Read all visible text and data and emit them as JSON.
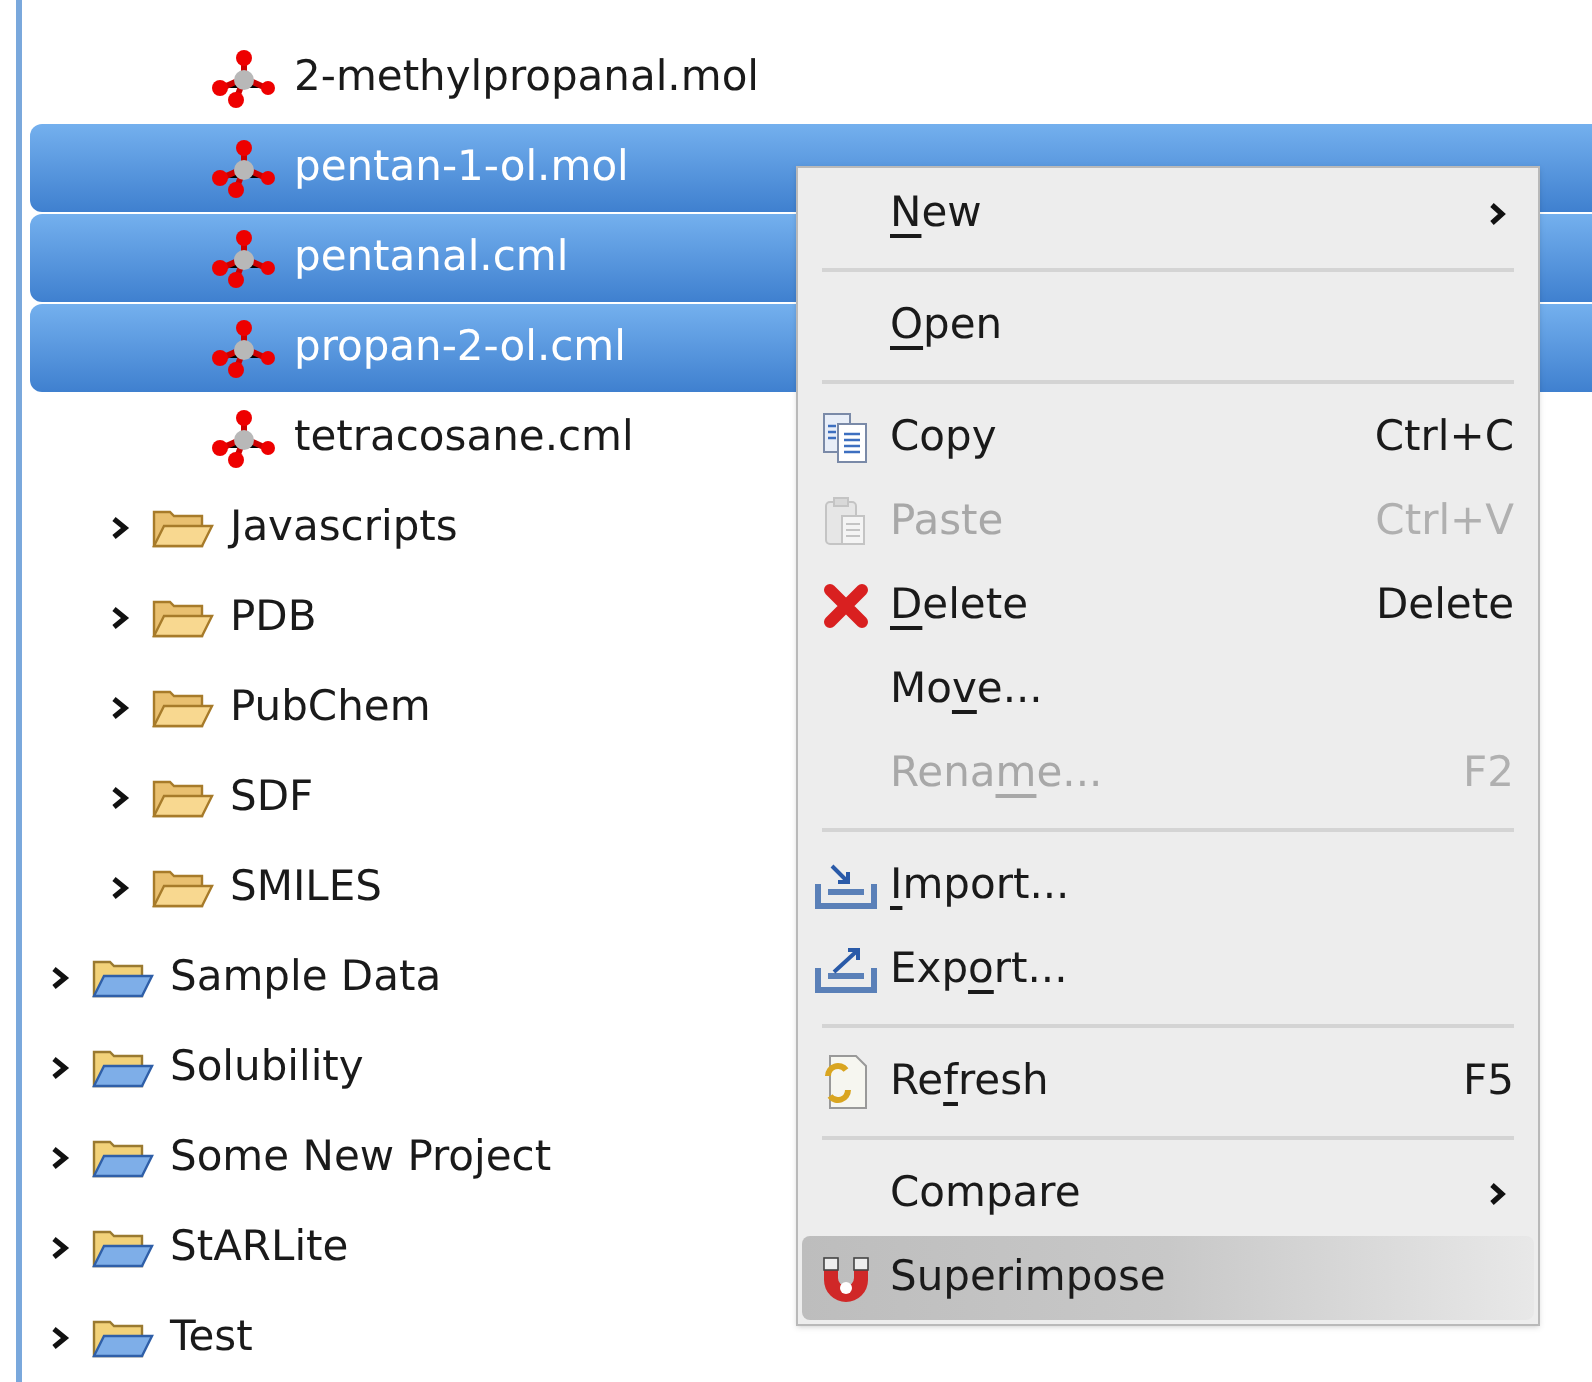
{
  "tree": [
    {
      "children": [
        {
          "children": [
            {
              "kind": "file",
              "label": "2-methylpropanal.mol",
              "selected": false
            },
            {
              "kind": "file",
              "label": "pentan-1-ol.mol",
              "selected": true
            },
            {
              "kind": "file",
              "label": "pentanal.cml",
              "selected": true
            },
            {
              "kind": "file",
              "label": "propan-2-ol.cml",
              "selected": true
            },
            {
              "kind": "file",
              "label": "tetracosane.cml",
              "selected": false
            }
          ]
        },
        {
          "kind": "folder",
          "label": "Javascripts",
          "selected": false,
          "expanded": false
        },
        {
          "kind": "folder",
          "label": "PDB",
          "selected": false,
          "expanded": false
        },
        {
          "kind": "folder",
          "label": "PubChem",
          "selected": false,
          "expanded": false
        },
        {
          "kind": "folder",
          "label": "SDF",
          "selected": false,
          "expanded": false
        },
        {
          "kind": "folder",
          "label": "SMILES",
          "selected": false,
          "expanded": false
        }
      ]
    },
    {
      "kind": "project",
      "label": "Sample Data",
      "selected": false,
      "expanded": false
    },
    {
      "kind": "project",
      "label": "Solubility",
      "selected": false,
      "expanded": false
    },
    {
      "kind": "project",
      "label": "Some New Project",
      "selected": false,
      "expanded": false
    },
    {
      "kind": "project",
      "label": "StARLite",
      "selected": false,
      "expanded": false
    },
    {
      "kind": "project",
      "label": "Test",
      "selected": false,
      "expanded": false
    }
  ],
  "context_menu": {
    "items": [
      {
        "kind": "submenu",
        "label_parts": [
          {
            "text": "N",
            "underlined": true
          },
          {
            "text": "ew",
            "underlined": false
          }
        ],
        "selected": false,
        "disabled": false
      },
      {
        "kind": "separator"
      },
      {
        "kind": "plain",
        "label_parts": [
          {
            "text": "O",
            "underlined": true
          },
          {
            "text": "pen",
            "underlined": false
          }
        ],
        "selected": false,
        "disabled": false
      },
      {
        "kind": "separator"
      },
      {
        "kind": "copy",
        "label_parts": [
          {
            "text": "Copy",
            "underlined": false
          }
        ],
        "shortcut": "Ctrl+C",
        "selected": false,
        "disabled": false
      },
      {
        "kind": "paste",
        "label_parts": [
          {
            "text": "Paste",
            "underlined": false
          }
        ],
        "shortcut": "Ctrl+V",
        "selected": false,
        "disabled": true
      },
      {
        "kind": "delete",
        "label_parts": [
          {
            "text": "D",
            "underlined": true
          },
          {
            "text": "elete",
            "underlined": false
          }
        ],
        "shortcut": "Delete",
        "selected": false,
        "disabled": false
      },
      {
        "kind": "plain",
        "label_parts": [
          {
            "text": "Mo",
            "underlined": false
          },
          {
            "text": "v",
            "underlined": true
          },
          {
            "text": "e...",
            "underlined": false
          }
        ],
        "selected": false,
        "disabled": false
      },
      {
        "kind": "plain",
        "label_parts": [
          {
            "text": "Rena",
            "underlined": false
          },
          {
            "text": "m",
            "underlined": true
          },
          {
            "text": "e...",
            "underlined": false
          }
        ],
        "shortcut": "F2",
        "selected": false,
        "disabled": true
      },
      {
        "kind": "separator"
      },
      {
        "kind": "import",
        "label_parts": [
          {
            "text": "I",
            "underlined": true
          },
          {
            "text": "mport...",
            "underlined": false
          }
        ],
        "selected": false,
        "disabled": false
      },
      {
        "kind": "export",
        "label_parts": [
          {
            "text": "Exp",
            "underlined": false
          },
          {
            "text": "o",
            "underlined": true
          },
          {
            "text": "rt...",
            "underlined": false
          }
        ],
        "selected": false,
        "disabled": false
      },
      {
        "kind": "separator"
      },
      {
        "kind": "refresh",
        "label_parts": [
          {
            "text": "Re",
            "underlined": false
          },
          {
            "text": "f",
            "underlined": true
          },
          {
            "text": "resh",
            "underlined": false
          }
        ],
        "shortcut": "F5",
        "selected": false,
        "disabled": false
      },
      {
        "kind": "separator"
      },
      {
        "kind": "submenu",
        "label_parts": [
          {
            "text": "Compare",
            "underlined": false
          }
        ],
        "selected": false,
        "disabled": false
      },
      {
        "kind": "superimpose",
        "label_parts": [
          {
            "text": "Superimpose",
            "underlined": false
          }
        ],
        "selected": true,
        "disabled": false
      }
    ]
  }
}
